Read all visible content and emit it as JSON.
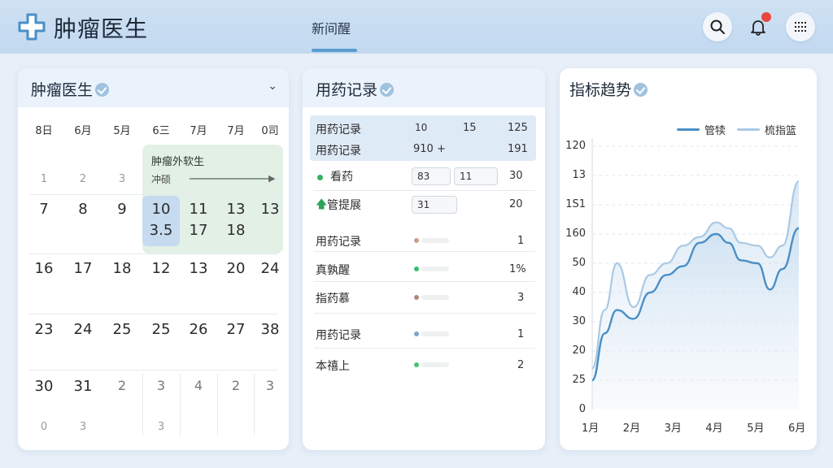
{
  "header": {
    "app_title": "肿瘤医生",
    "nav_tab": "新间醒",
    "icons": [
      "plus-cross-logo-icon",
      "search-icon",
      "bell-icon",
      "menu-icon"
    ],
    "accent": "#5a9bd1"
  },
  "calendar": {
    "title": "肿瘤医生",
    "weekday_headers": [
      "8日",
      "6月",
      "5月",
      "6三",
      "7月",
      "7月",
      "0司"
    ],
    "rows": [
      [
        "1",
        "2",
        "3",
        "",
        "",
        "",
        ""
      ],
      [
        "7",
        "8",
        "9",
        "10",
        "11",
        "13",
        "13"
      ],
      [
        "",
        "",
        "",
        "3.5",
        "17",
        "18",
        ""
      ],
      [
        "16",
        "17",
        "18",
        "12",
        "13",
        "20",
        "24"
      ],
      [
        "23",
        "24",
        "25",
        "25",
        "26",
        "27",
        "38"
      ],
      [
        "30",
        "31",
        "2",
        "3",
        "4",
        "2",
        "3"
      ],
      [
        "0",
        "3",
        "",
        "3",
        "",
        "",
        ""
      ]
    ],
    "event": {
      "title": "肿瘤外软生",
      "subtitle": "冲硕"
    }
  },
  "medication": {
    "title": "用药记录",
    "header_rows": [
      {
        "label": "用药记录",
        "c1": "10",
        "c2": "15",
        "c3": "125"
      },
      {
        "label": "用药记录",
        "c1": "910 +",
        "c2": "",
        "c3": "191"
      }
    ],
    "rows": [
      {
        "label": "看药",
        "box1": "83",
        "box2": "11",
        "value": "30",
        "marker": "green-dot"
      },
      {
        "label": "管提展",
        "box1": "31",
        "box2": "",
        "value": "20",
        "marker": "green-arrow"
      },
      {
        "label": "用药记录",
        "value": "1",
        "dot_color": "#c9a08a"
      },
      {
        "label": "真孰醒",
        "value": "1%",
        "dot_color": "#34c06e"
      },
      {
        "label": "指药慕",
        "value": "3",
        "dot_color": "#b08878"
      },
      {
        "label": "用药记录",
        "value": "1",
        "dot_color": "#7fa6c9"
      },
      {
        "label": "本禧上",
        "value": "2",
        "dot_color": "#46c46e"
      }
    ]
  },
  "trend": {
    "title": "指标趋势"
  },
  "chart_data": {
    "type": "area",
    "title": "指标趋势",
    "xlabel": "",
    "ylabel": "",
    "categories": [
      "1月",
      "2月",
      "3月",
      "4月",
      "5月",
      "6月"
    ],
    "yticks": [
      "0",
      "25",
      "20",
      "30",
      "40",
      "50",
      "160",
      "1S1",
      "13",
      "120"
    ],
    "x": [
      1.0,
      1.3,
      1.6,
      2.0,
      2.4,
      2.8,
      3.2,
      3.6,
      4.0,
      4.3,
      4.6,
      5.0,
      5.3,
      5.6,
      6.0
    ],
    "series": [
      {
        "name": "管犊",
        "color": "#4a8fc7",
        "values": [
          1.0,
          2.6,
          3.4,
          3.1,
          4.0,
          4.6,
          4.9,
          5.7,
          6.0,
          5.7,
          5.1,
          5.0,
          4.1,
          4.8,
          6.2
        ]
      },
      {
        "name": "梳指篮",
        "color": "#aac9e4",
        "values": [
          1.4,
          3.4,
          5.0,
          3.5,
          4.6,
          5.0,
          5.6,
          5.9,
          6.4,
          6.2,
          5.7,
          5.6,
          5.2,
          5.6,
          7.8
        ]
      }
    ],
    "ylim": [
      0,
      9
    ],
    "grid": true,
    "legend": "top-right"
  }
}
